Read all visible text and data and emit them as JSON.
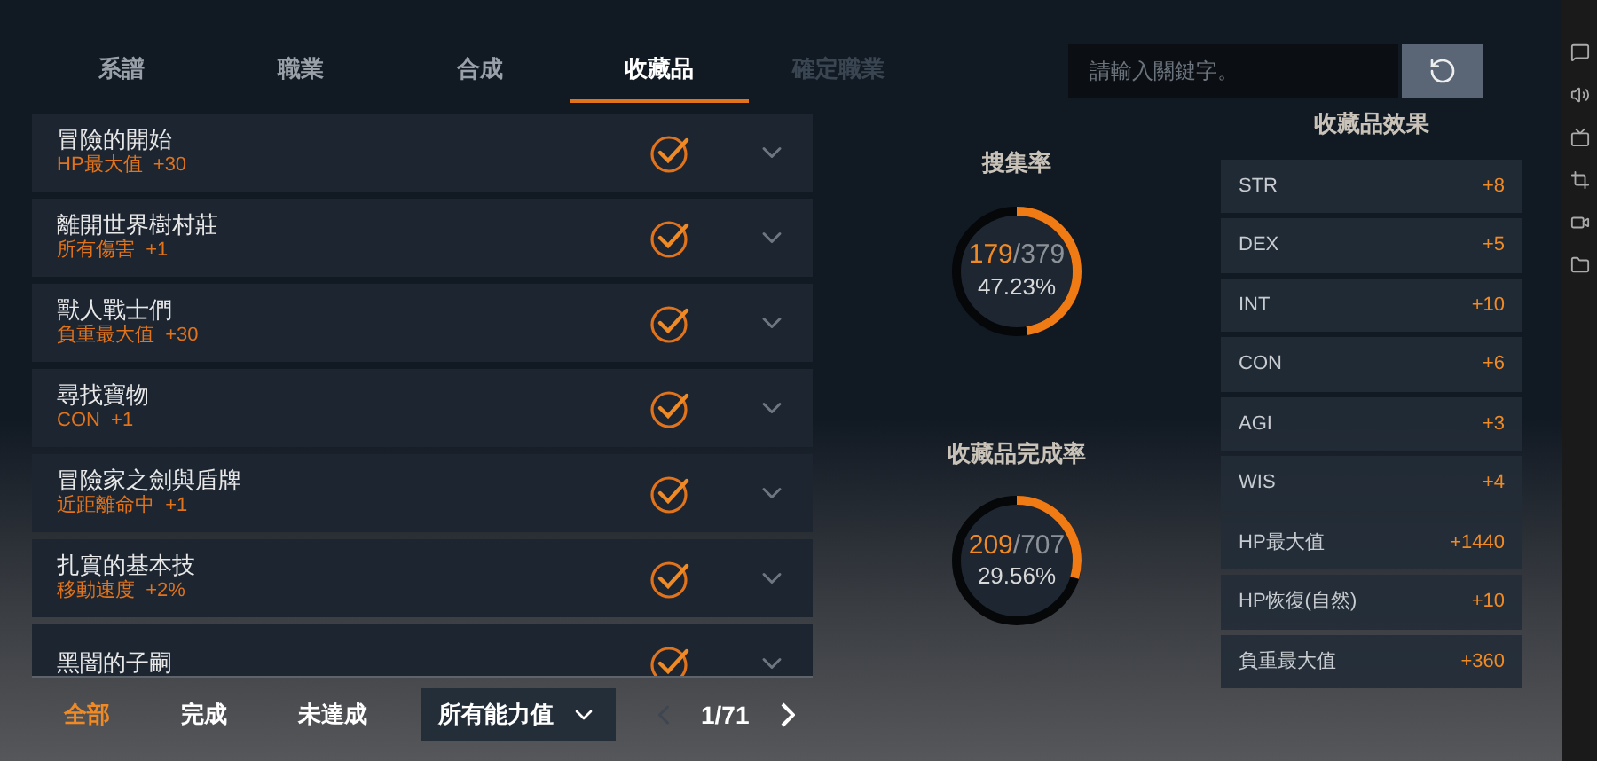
{
  "tabs": [
    {
      "label": "系譜",
      "selected": false,
      "disabled": false
    },
    {
      "label": "職業",
      "selected": false,
      "disabled": false
    },
    {
      "label": "合成",
      "selected": false,
      "disabled": false
    },
    {
      "label": "收藏品",
      "selected": true,
      "disabled": false
    },
    {
      "label": "確定職業",
      "selected": false,
      "disabled": true
    }
  ],
  "search": {
    "placeholder": "請輸入關鍵字。"
  },
  "collections": [
    {
      "name": "冒險的開始",
      "effect": "HP最大值  +30",
      "completed": true
    },
    {
      "name": "離開世界樹村莊",
      "effect": "所有傷害  +1",
      "completed": true
    },
    {
      "name": "獸人戰士們",
      "effect": "負重最大值  +30",
      "completed": true
    },
    {
      "name": "尋找寶物",
      "effect": "CON  +1",
      "completed": true
    },
    {
      "name": "冒險家之劍與盾牌",
      "effect": "近距離命中  +1",
      "completed": true
    },
    {
      "name": "扎實的基本技",
      "effect": "移動速度  +2%",
      "completed": true
    },
    {
      "name": "黑闇的子嗣",
      "completed": true
    }
  ],
  "filters": [
    {
      "label": "全部",
      "selected": true
    },
    {
      "label": "完成",
      "selected": false
    },
    {
      "label": "未達成",
      "selected": false
    }
  ],
  "stat_dropdown": {
    "value": "所有能力值"
  },
  "pager": {
    "page": "1/71",
    "prev_disabled": true
  },
  "rates": [
    {
      "title": "搜集率",
      "done": "179",
      "separator": "/",
      "total": "379",
      "percent": "47.23%",
      "level": 0.4723
    },
    {
      "title": "收藏品完成率",
      "done": "209",
      "separator": "/",
      "total": "707",
      "percent": "29.56%",
      "level": 0.2956
    }
  ],
  "effects": {
    "title": "收藏品效果",
    "items": [
      {
        "stat": "STR",
        "value": "+8"
      },
      {
        "stat": "DEX",
        "value": "+5"
      },
      {
        "stat": "INT",
        "value": "+10"
      },
      {
        "stat": "CON",
        "value": "+6"
      },
      {
        "stat": "AGI",
        "value": "+3"
      },
      {
        "stat": "WIS",
        "value": "+4"
      },
      {
        "stat": "HP最大值",
        "value": "+1440"
      },
      {
        "stat": "HP恢復(自然)",
        "value": "+10"
      },
      {
        "stat": "負重最大值",
        "value": "+360"
      }
    ]
  }
}
